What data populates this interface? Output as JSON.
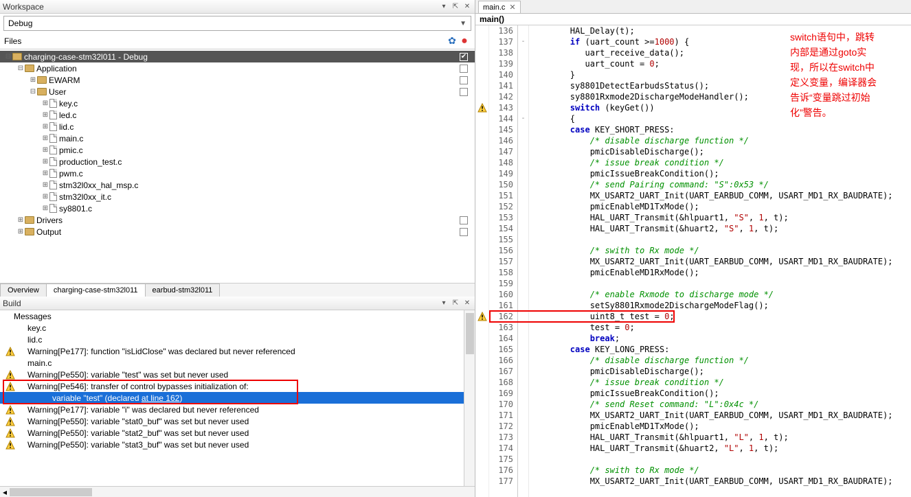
{
  "workspace": {
    "title": "Workspace",
    "config": "Debug",
    "files_label": "Files",
    "tree": [
      {
        "depth": 0,
        "type": "folder",
        "label": "charging-case-stm32l011 - Debug",
        "expanded": true,
        "selected": true,
        "check": true
      },
      {
        "depth": 1,
        "type": "folder",
        "label": "Application",
        "expanded": true,
        "check": false
      },
      {
        "depth": 2,
        "type": "folder",
        "label": "EWARM",
        "expanded": false,
        "check": false
      },
      {
        "depth": 2,
        "type": "folder",
        "label": "User",
        "expanded": true,
        "check": false
      },
      {
        "depth": 3,
        "type": "file",
        "label": "key.c",
        "expanded": false
      },
      {
        "depth": 3,
        "type": "file",
        "label": "led.c",
        "expanded": false
      },
      {
        "depth": 3,
        "type": "file",
        "label": "lid.c",
        "expanded": false
      },
      {
        "depth": 3,
        "type": "file",
        "label": "main.c",
        "expanded": false
      },
      {
        "depth": 3,
        "type": "file",
        "label": "pmic.c",
        "expanded": false
      },
      {
        "depth": 3,
        "type": "file",
        "label": "production_test.c",
        "expanded": false
      },
      {
        "depth": 3,
        "type": "file",
        "label": "pwm.c",
        "expanded": false
      },
      {
        "depth": 3,
        "type": "file",
        "label": "stm32l0xx_hal_msp.c",
        "expanded": false
      },
      {
        "depth": 3,
        "type": "file",
        "label": "stm32l0xx_it.c",
        "expanded": false
      },
      {
        "depth": 3,
        "type": "file",
        "label": "sy8801.c",
        "expanded": false
      },
      {
        "depth": 1,
        "type": "folder",
        "label": "Drivers",
        "expanded": false,
        "check": false
      },
      {
        "depth": 1,
        "type": "folder",
        "label": "Output",
        "expanded": false,
        "check": false
      }
    ],
    "tabs": [
      "Overview",
      "charging-case-stm32l011",
      "earbud-stm32l011"
    ]
  },
  "build": {
    "title": "Build",
    "header": "Messages",
    "rows": [
      {
        "warn": false,
        "text": "key.c",
        "indent": 1
      },
      {
        "warn": false,
        "text": "lid.c",
        "indent": 1
      },
      {
        "warn": true,
        "text": "Warning[Pe177]: function \"isLidClose\" was declared but never referenced",
        "indent": 1
      },
      {
        "warn": false,
        "text": "main.c",
        "indent": 1
      },
      {
        "warn": true,
        "text": "Warning[Pe550]: variable \"test\" was set but never used",
        "indent": 1
      },
      {
        "warn": true,
        "text": "Warning[Pe546]: transfer of control bypasses initialization of:",
        "indent": 1,
        "boxed": true
      },
      {
        "warn": false,
        "text": "variable \"test\" (declared ",
        "indent": 4,
        "selected": true,
        "link": "at line 162",
        "tail": ")",
        "boxed": true
      },
      {
        "warn": true,
        "text": "Warning[Pe177]: variable \"i\" was declared but never referenced",
        "indent": 1
      },
      {
        "warn": true,
        "text": "Warning[Pe550]: variable \"stat0_buf\" was set but never used",
        "indent": 1
      },
      {
        "warn": true,
        "text": "Warning[Pe550]: variable \"stat2_buf\" was set but never used",
        "indent": 1
      },
      {
        "warn": true,
        "text": "Warning[Pe550]: variable \"stat3_buf\" was set but never used",
        "indent": 1
      }
    ]
  },
  "editor": {
    "tab": "main.c",
    "func": "main()",
    "first_line": 136,
    "markers": {
      "143": "warn",
      "162": "warn"
    },
    "fold": {
      "137": "-",
      "144": "-"
    },
    "highlighted_line": 162,
    "lines": [
      {
        "t": "        HAL_Delay(t);",
        "segs": [
          [
            "        HAL_Delay(t);",
            ""
          ]
        ]
      },
      {
        "segs": [
          [
            "        ",
            ""
          ],
          [
            "if",
            1
          ],
          [
            " (uart_count >=",
            ""
          ],
          [
            "1000",
            2
          ],
          [
            ") {",
            ""
          ]
        ]
      },
      {
        "segs": [
          [
            "           uart_receive_data();",
            ""
          ]
        ]
      },
      {
        "segs": [
          [
            "           uart_count = ",
            ""
          ],
          [
            "0",
            2
          ],
          [
            ";",
            ""
          ]
        ]
      },
      {
        "segs": [
          [
            "        }",
            ""
          ]
        ]
      },
      {
        "segs": [
          [
            "        sy8801DetectEarbudsStatus();",
            ""
          ]
        ]
      },
      {
        "segs": [
          [
            "        sy8801Rxmode2DischargeModeHandler();",
            ""
          ]
        ]
      },
      {
        "segs": [
          [
            "        ",
            ""
          ],
          [
            "switch",
            1
          ],
          [
            " (keyGet())",
            ""
          ]
        ]
      },
      {
        "segs": [
          [
            "        {",
            ""
          ]
        ]
      },
      {
        "segs": [
          [
            "        ",
            ""
          ],
          [
            "case",
            1
          ],
          [
            " KEY_SHORT_PRESS:",
            ""
          ]
        ]
      },
      {
        "segs": [
          [
            "            ",
            ""
          ],
          [
            "/* disable discharge function */",
            3
          ]
        ]
      },
      {
        "segs": [
          [
            "            pmicDisableDischarge();",
            ""
          ]
        ]
      },
      {
        "segs": [
          [
            "            ",
            ""
          ],
          [
            "/* issue break condition */",
            3
          ]
        ]
      },
      {
        "segs": [
          [
            "            pmicIssueBreakCondition();",
            ""
          ]
        ]
      },
      {
        "segs": [
          [
            "            ",
            ""
          ],
          [
            "/* send Pairing command: \"S\":0x53 */",
            3
          ]
        ]
      },
      {
        "segs": [
          [
            "            MX_USART2_UART_Init(UART_EARBUD_COMM, USART_MD1_RX_BAUDRATE);",
            ""
          ]
        ]
      },
      {
        "segs": [
          [
            "            pmicEnableMD1TxMode();",
            ""
          ]
        ]
      },
      {
        "segs": [
          [
            "            HAL_UART_Transmit(&hlpuart1, ",
            ""
          ],
          [
            "\"S\"",
            2
          ],
          [
            ", ",
            ""
          ],
          [
            "1",
            2
          ],
          [
            ", t);",
            ""
          ]
        ]
      },
      {
        "segs": [
          [
            "            HAL_UART_Transmit(&huart2, ",
            ""
          ],
          [
            "\"S\"",
            2
          ],
          [
            ", ",
            ""
          ],
          [
            "1",
            2
          ],
          [
            ", t);",
            ""
          ]
        ]
      },
      {
        "segs": [
          [
            "",
            ""
          ]
        ]
      },
      {
        "segs": [
          [
            "            ",
            ""
          ],
          [
            "/* swith to Rx mode */",
            3
          ]
        ]
      },
      {
        "segs": [
          [
            "            MX_USART2_UART_Init(UART_EARBUD_COMM, USART_MD1_RX_BAUDRATE);",
            ""
          ]
        ]
      },
      {
        "segs": [
          [
            "            pmicEnableMD1RxMode();",
            ""
          ]
        ]
      },
      {
        "segs": [
          [
            "",
            ""
          ]
        ]
      },
      {
        "segs": [
          [
            "            ",
            ""
          ],
          [
            "/* enable Rxmode to discharge mode */",
            3
          ]
        ]
      },
      {
        "segs": [
          [
            "            setSy8801Rxmode2DischargeModeFlag();",
            ""
          ]
        ]
      },
      {
        "segs": [
          [
            "            uint8_t test = ",
            ""
          ],
          [
            "0",
            2
          ],
          [
            ";",
            ""
          ]
        ]
      },
      {
        "segs": [
          [
            "            test = ",
            ""
          ],
          [
            "0",
            2
          ],
          [
            ";",
            ""
          ]
        ]
      },
      {
        "segs": [
          [
            "            ",
            ""
          ],
          [
            "break",
            1
          ],
          [
            ";",
            ""
          ]
        ]
      },
      {
        "segs": [
          [
            "        ",
            ""
          ],
          [
            "case",
            1
          ],
          [
            " KEY_LONG_PRESS:",
            ""
          ]
        ]
      },
      {
        "segs": [
          [
            "            ",
            ""
          ],
          [
            "/* disable discharge function */",
            3
          ]
        ]
      },
      {
        "segs": [
          [
            "            pmicDisableDischarge();",
            ""
          ]
        ]
      },
      {
        "segs": [
          [
            "            ",
            ""
          ],
          [
            "/* issue break condition */",
            3
          ]
        ]
      },
      {
        "segs": [
          [
            "            pmicIssueBreakCondition();",
            ""
          ]
        ]
      },
      {
        "segs": [
          [
            "            ",
            ""
          ],
          [
            "/* send Reset command: \"L\":0x4c */",
            3
          ]
        ]
      },
      {
        "segs": [
          [
            "            MX_USART2_UART_Init(UART_EARBUD_COMM, USART_MD1_RX_BAUDRATE);",
            ""
          ]
        ]
      },
      {
        "segs": [
          [
            "            pmicEnableMD1TxMode();",
            ""
          ]
        ]
      },
      {
        "segs": [
          [
            "            HAL_UART_Transmit(&hlpuart1, ",
            ""
          ],
          [
            "\"L\"",
            2
          ],
          [
            ", ",
            ""
          ],
          [
            "1",
            2
          ],
          [
            ", t);",
            ""
          ]
        ]
      },
      {
        "segs": [
          [
            "            HAL_UART_Transmit(&huart2, ",
            ""
          ],
          [
            "\"L\"",
            2
          ],
          [
            ", ",
            ""
          ],
          [
            "1",
            2
          ],
          [
            ", t);",
            ""
          ]
        ]
      },
      {
        "segs": [
          [
            "",
            ""
          ]
        ]
      },
      {
        "segs": [
          [
            "            ",
            ""
          ],
          [
            "/* swith to Rx mode */",
            3
          ]
        ]
      },
      {
        "segs": [
          [
            "            MX_USART2_UART_Init(UART_EARBUD_COMM, USART_MD1_RX_BAUDRATE);",
            ""
          ]
        ]
      }
    ]
  },
  "annotation": {
    "lines": [
      "switch语句中，跳转",
      "内部是通过goto实",
      "现，所以在switch中",
      "定义变量，编译器会",
      "告诉“变量跳过初始",
      "化”警告。"
    ]
  }
}
